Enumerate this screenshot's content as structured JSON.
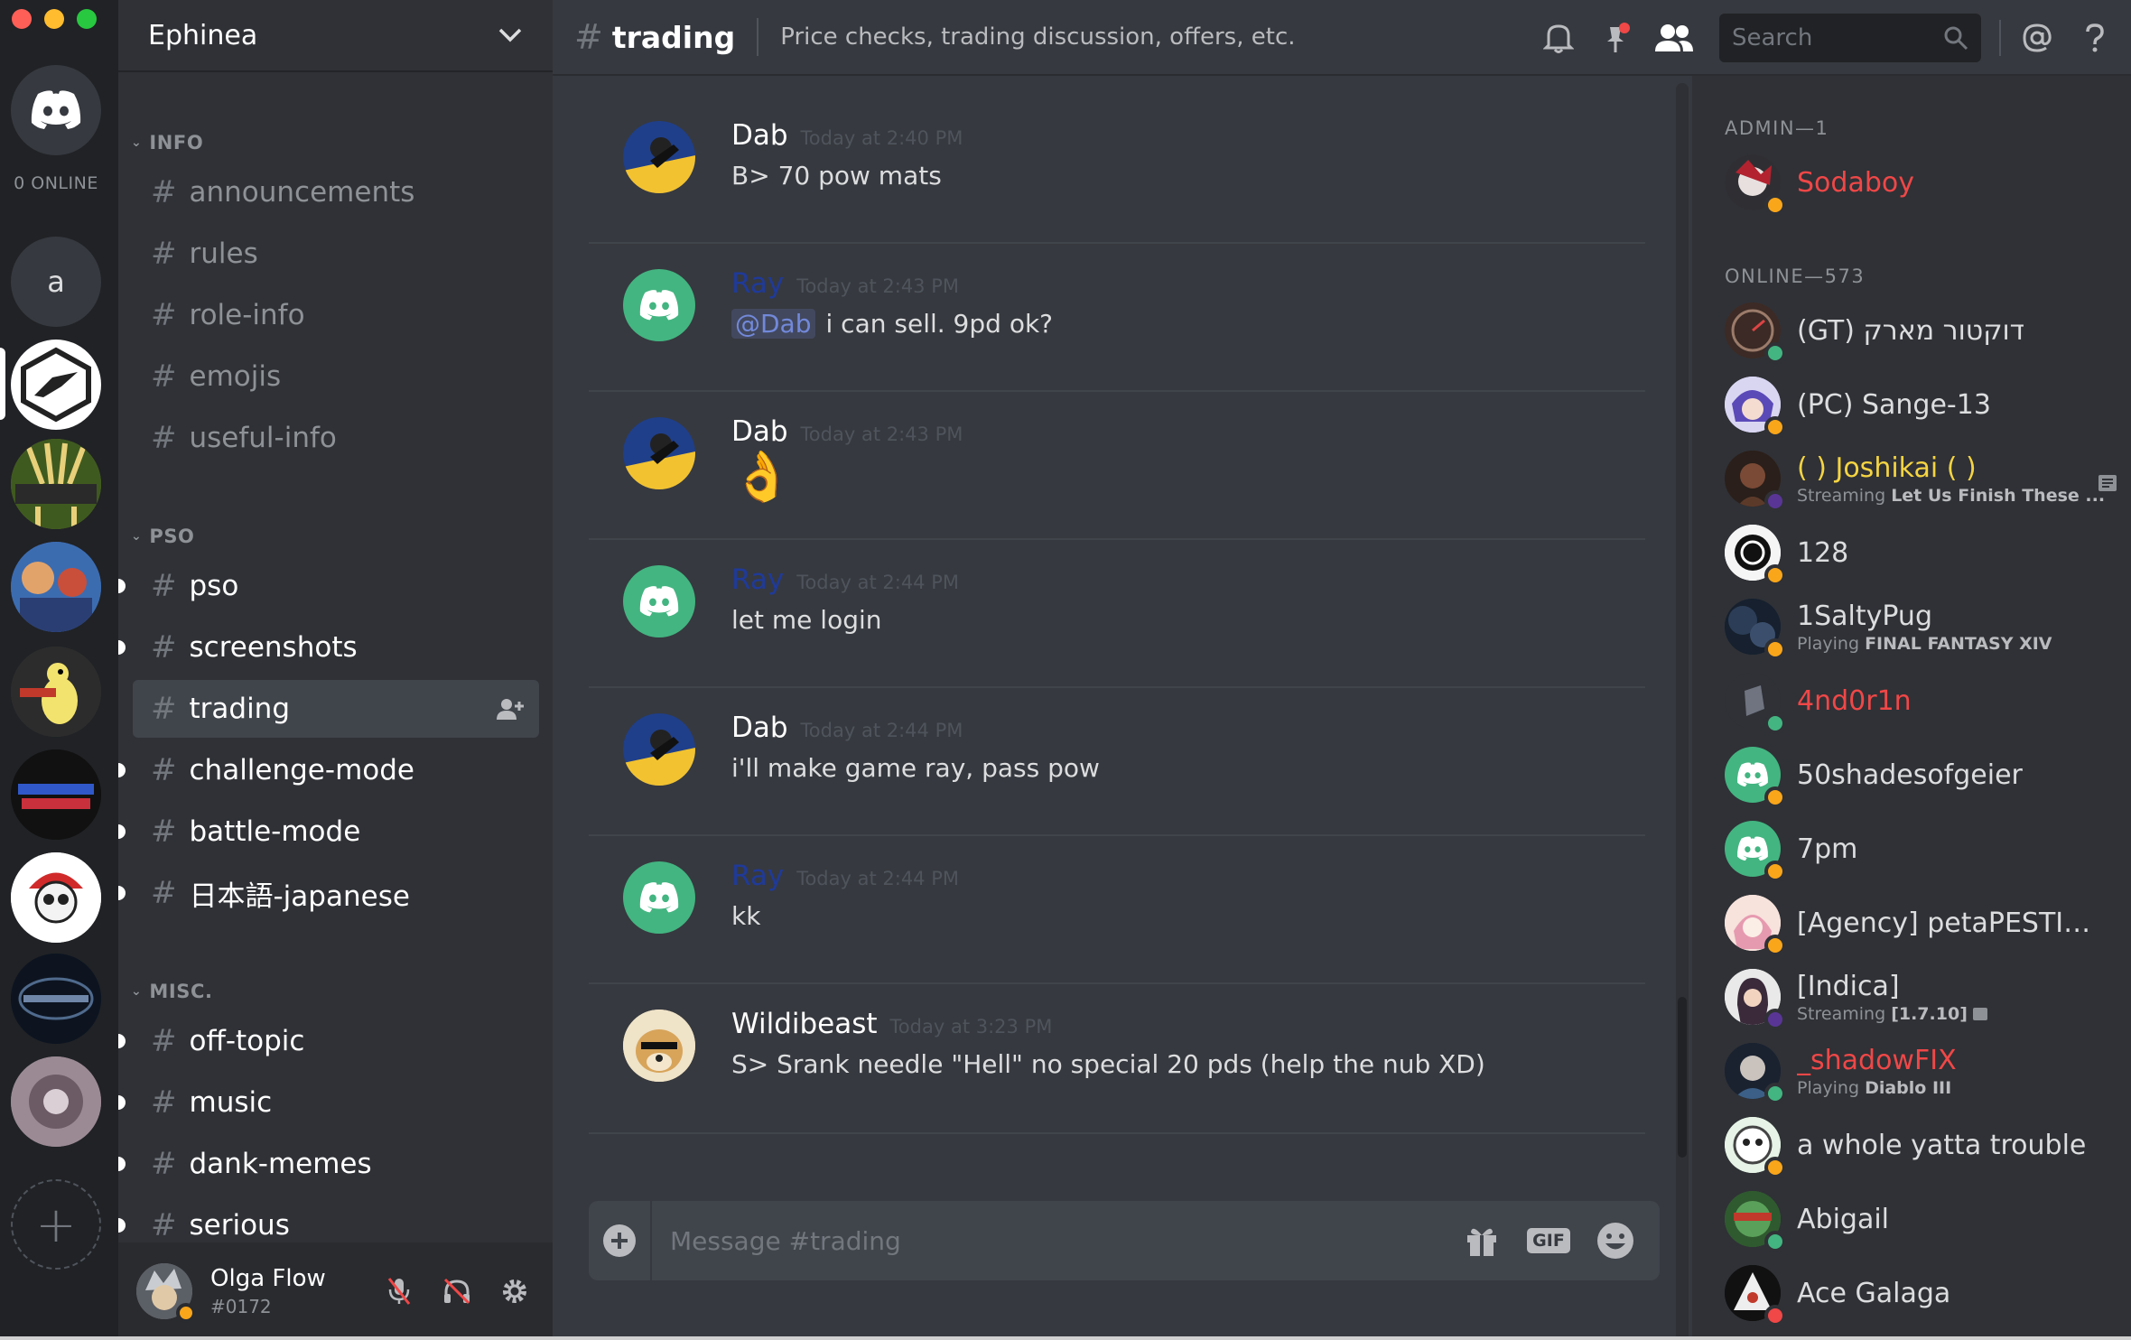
{
  "window": {
    "traffic_colors": [
      "#ff5f57",
      "#febc2e",
      "#28c840"
    ]
  },
  "rail": {
    "online_label": "0 ONLINE",
    "server_letter": "a"
  },
  "sidebar": {
    "guild_name": "Ephinea",
    "categories": [
      "INFO",
      "PSO",
      "MISC."
    ],
    "channels": [
      "announcements",
      "rules",
      "role-info",
      "emojis",
      "useful-info",
      "pso",
      "screenshots",
      "trading",
      "challenge-mode",
      "battle-mode",
      "日本語-japanese",
      "off-topic",
      "music",
      "dank-memes",
      "serious"
    ],
    "user": {
      "name": "Olga Flow",
      "tag": "#0172"
    }
  },
  "header": {
    "channel": "trading",
    "topic": "Price checks, trading discussion, offers, etc.",
    "search_placeholder": "Search"
  },
  "messages": [
    {
      "author": "Dab",
      "time": "Today at 2:40 PM",
      "text": "B> 70 pow mats"
    },
    {
      "author": "Ray",
      "time": "Today at 2:43 PM",
      "mention": "@Dab",
      "text": "i can sell. 9pd ok?"
    },
    {
      "author": "Dab",
      "time": "Today at 2:43 PM",
      "text": "👌"
    },
    {
      "author": "Ray",
      "time": "Today at 2:44 PM",
      "text": "let me login"
    },
    {
      "author": "Dab",
      "time": "Today at 2:44 PM",
      "text": "i'll make game ray, pass pow"
    },
    {
      "author": "Ray",
      "time": "Today at 2:44 PM",
      "text": "kk"
    },
    {
      "author": "Wildibeast",
      "time": "Today at 3:23 PM",
      "text": "S> Srank needle \"Hell\" no special 20 pds (help the nub XD)"
    }
  ],
  "composer": {
    "placeholder": "Message #trading",
    "gif_label": "GIF"
  },
  "members": {
    "groups": [
      "ADMIN—1",
      "ONLINE—573"
    ],
    "list": [
      {
        "name": "Sodaboy"
      },
      {
        "name": "(GT) דוקטור מארק"
      },
      {
        "name": "(PC) Sange-13"
      },
      {
        "name": "( ) Joshikai ( )",
        "activity_prefix": "Streaming",
        "activity": "Let Us Finish These ..."
      },
      {
        "name": "128"
      },
      {
        "name": "1SaltyPug",
        "activity_prefix": "Playing",
        "activity": "FINAL FANTASY XIV"
      },
      {
        "name": "4nd0r1n"
      },
      {
        "name": "50shadesofgeier"
      },
      {
        "name": "7pm"
      },
      {
        "name": "[Agency] petaPESTILE..."
      },
      {
        "name": "[Indica]",
        "activity_prefix": "Streaming",
        "activity": "[1.7.10]"
      },
      {
        "name": "_shadowFIX",
        "activity_prefix": "Playing",
        "activity": "Diablo III"
      },
      {
        "name": "a whole yatta trouble"
      },
      {
        "name": "Abigail"
      },
      {
        "name": "Ace Galaga"
      }
    ]
  }
}
